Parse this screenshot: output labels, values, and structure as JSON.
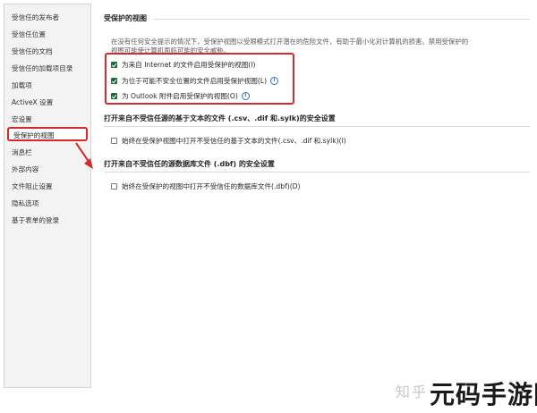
{
  "sidebar": {
    "items": [
      {
        "label": "受信任的发布者"
      },
      {
        "label": "受信任位置"
      },
      {
        "label": "受信任的文档"
      },
      {
        "label": "受信任的加载项目录"
      },
      {
        "label": "加载项"
      },
      {
        "label": "ActiveX 设置"
      },
      {
        "label": "宏设置"
      },
      {
        "label": "受保护的视图"
      },
      {
        "label": "消息栏"
      },
      {
        "label": "外部内容"
      },
      {
        "label": "文件阻止设置"
      },
      {
        "label": "隐私选项"
      },
      {
        "label": "基于表单的登录"
      }
    ],
    "selected_index": 7
  },
  "protected_view": {
    "title": "受保护的视图",
    "description_line1": "在没有任何安全提示的情况下，受保护视图以受限模式打开潜在的危险文件，有助于最小化对计算机的损害。禁用受保护的",
    "description_line2": "视图可能使计算机面临可能的安全威胁。",
    "options": [
      {
        "label": "为来自 Internet 的文件启用受保护的视图(I)",
        "checked": true
      },
      {
        "label": "为位于可能不安全位置的文件启用受保护视图(L)",
        "checked": true
      },
      {
        "label": "为 Outlook 附件启用受保护的视图(O)",
        "checked": true
      }
    ],
    "info_glyph": "i"
  },
  "text_files": {
    "title": "打开来自不受信任源的基于文本的文件 (.csv、.dif 和.sylk)的安全设置",
    "option": {
      "label": "始终在受保护视图中打开不受信任的基于文本的文件(.csv、.dif 和.sylk)(I)",
      "checked": false
    }
  },
  "dbf_files": {
    "title": "打开来自不受信任的源数据库文件 (.dbf) 的安全设置",
    "option": {
      "label": "始终在受保护的视图中打开不受信任的数据库文件(.dbf)(D)",
      "checked": false
    }
  },
  "watermark": {
    "zhihu": "知乎",
    "logo": "元码手游网"
  },
  "colors": {
    "highlight": "#d32b2b",
    "checkbox": "#1e6b3c",
    "info": "#2f6ec6"
  }
}
